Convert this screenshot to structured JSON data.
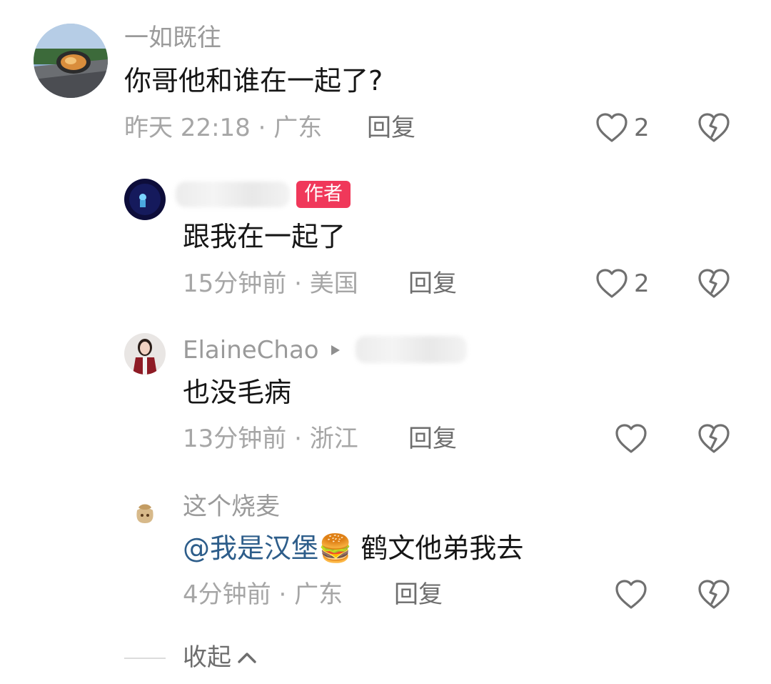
{
  "comments": [
    {
      "username": "一如既往",
      "text": "你哥他和谁在一起了?",
      "time": "昨天 22:18",
      "location": "广东",
      "reply_label": "回复",
      "likes": "2"
    },
    {
      "author_tag": "作者",
      "text": "跟我在一起了",
      "time": "15分钟前",
      "location": "美国",
      "reply_label": "回复",
      "likes": "2"
    },
    {
      "username": "ElaineChao",
      "text": "也没毛病",
      "time": "13分钟前",
      "location": "浙江",
      "reply_label": "回复"
    },
    {
      "username": "这个烧麦",
      "mention": "@我是汉堡🍔",
      "text": "鹤文他弟我去",
      "time": "4分钟前",
      "location": "广东",
      "reply_label": "回复"
    }
  ],
  "separator": " · ",
  "collapse_label": "收起",
  "colors": {
    "author_tag": "#f0385a",
    "mention": "#2d5d8a",
    "meta": "#a6a6a6"
  },
  "icons": [
    "heart-outline-icon",
    "broken-heart-icon",
    "chevron-up-icon",
    "reply-arrow-icon"
  ]
}
